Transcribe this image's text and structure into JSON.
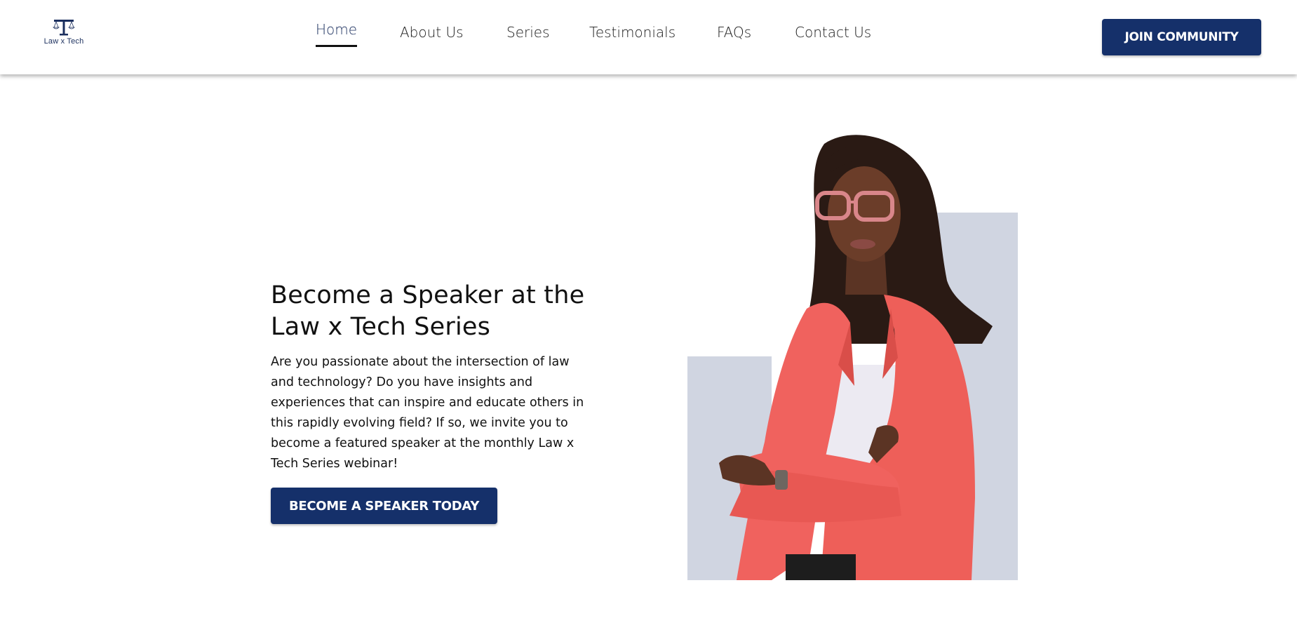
{
  "header": {
    "logo_text": "Law x Tech",
    "nav": [
      {
        "label": "Home",
        "active": true
      },
      {
        "label": "About Us",
        "active": false
      },
      {
        "label": "Series",
        "active": false
      },
      {
        "label": "Testimonials",
        "active": false
      },
      {
        "label": "FAQs",
        "active": false
      },
      {
        "label": "Contact Us",
        "active": false
      }
    ],
    "join_label": "JOIN COMMUNITY"
  },
  "hero": {
    "title": "Become a Speaker at the Law x Tech Series",
    "description": "Are you passionate about the intersection of law and technology? Do you have insights and experiences that can inspire and educate others in this rapidly evolving field? If so, we invite you to become a featured speaker at the monthly Law x Tech Series webinar!",
    "cta_label": "BECOME A SPEAKER TODAY"
  },
  "colors": {
    "primary": "#15306a",
    "photo_backdrop": "#d0d5e1",
    "blazer": "#f0625e"
  },
  "icons": {
    "logo": "scales-of-justice-t-icon"
  }
}
